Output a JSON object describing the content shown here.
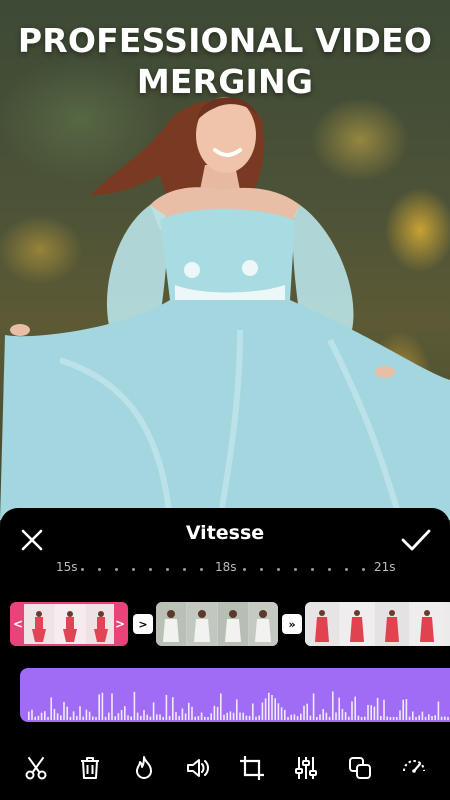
{
  "hero": {
    "title": "PROFESSIONAL VIDEO\nMERGING"
  },
  "editor": {
    "title": "Vitesse",
    "close_icon": "close-icon",
    "confirm_icon": "check-icon"
  },
  "timeline": {
    "ruler": [
      {
        "label": "15s"
      },
      {
        "label": "18s"
      },
      {
        "label": "21s"
      }
    ],
    "clips": [
      {
        "name": "clip-1",
        "selected": true
      },
      {
        "name": "clip-2",
        "selected": false
      },
      {
        "name": "clip-3",
        "selected": false
      }
    ],
    "transitions": [
      {
        "glyph": ">"
      },
      {
        "glyph": "»"
      }
    ],
    "handles": {
      "left": "<",
      "right": ">"
    }
  },
  "audio": {
    "color": "#a06cf5"
  },
  "toolbar": {
    "tools": [
      {
        "icon": "scissors-icon"
      },
      {
        "icon": "trash-icon"
      },
      {
        "icon": "flame-icon"
      },
      {
        "icon": "volume-icon"
      },
      {
        "icon": "crop-icon"
      },
      {
        "icon": "adjust-sliders-icon"
      },
      {
        "icon": "duplicate-icon"
      },
      {
        "icon": "speed-icon"
      }
    ]
  },
  "colors": {
    "accent_pink": "#e8447a",
    "waveform_purple": "#a06cf5",
    "panel_bg": "#000000"
  }
}
